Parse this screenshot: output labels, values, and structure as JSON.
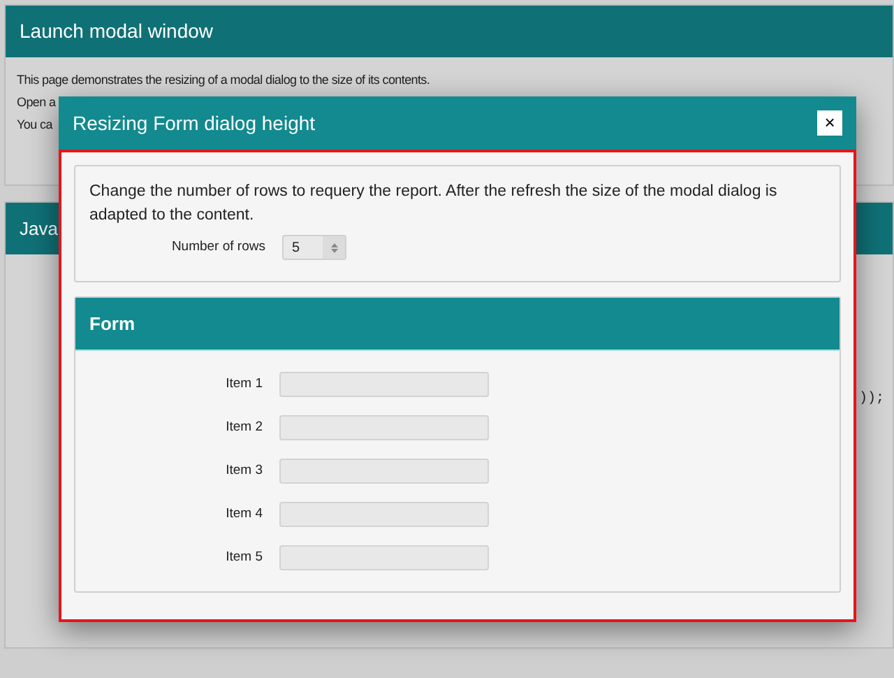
{
  "background_page": {
    "panels": [
      {
        "title": "Launch modal window",
        "lines": [
          "This page demonstrates the resizing of a modal dialog to the size of its contents.",
          "Open a",
          "You ca"
        ]
      },
      {
        "title": "Java",
        "code": "));"
      }
    ]
  },
  "dialog": {
    "title": "Resizing Form dialog height",
    "close_label": "×",
    "intro": "Change the number of rows to requery the report. After the refresh the size of the modal dialog is adapted to the content.",
    "rows_field": {
      "label": "Number of rows",
      "value": "5"
    },
    "form": {
      "title": "Form",
      "items": [
        {
          "label": "Item 1"
        },
        {
          "label": "Item 2"
        },
        {
          "label": "Item 3"
        },
        {
          "label": "Item 4"
        },
        {
          "label": "Item 5"
        }
      ]
    }
  }
}
